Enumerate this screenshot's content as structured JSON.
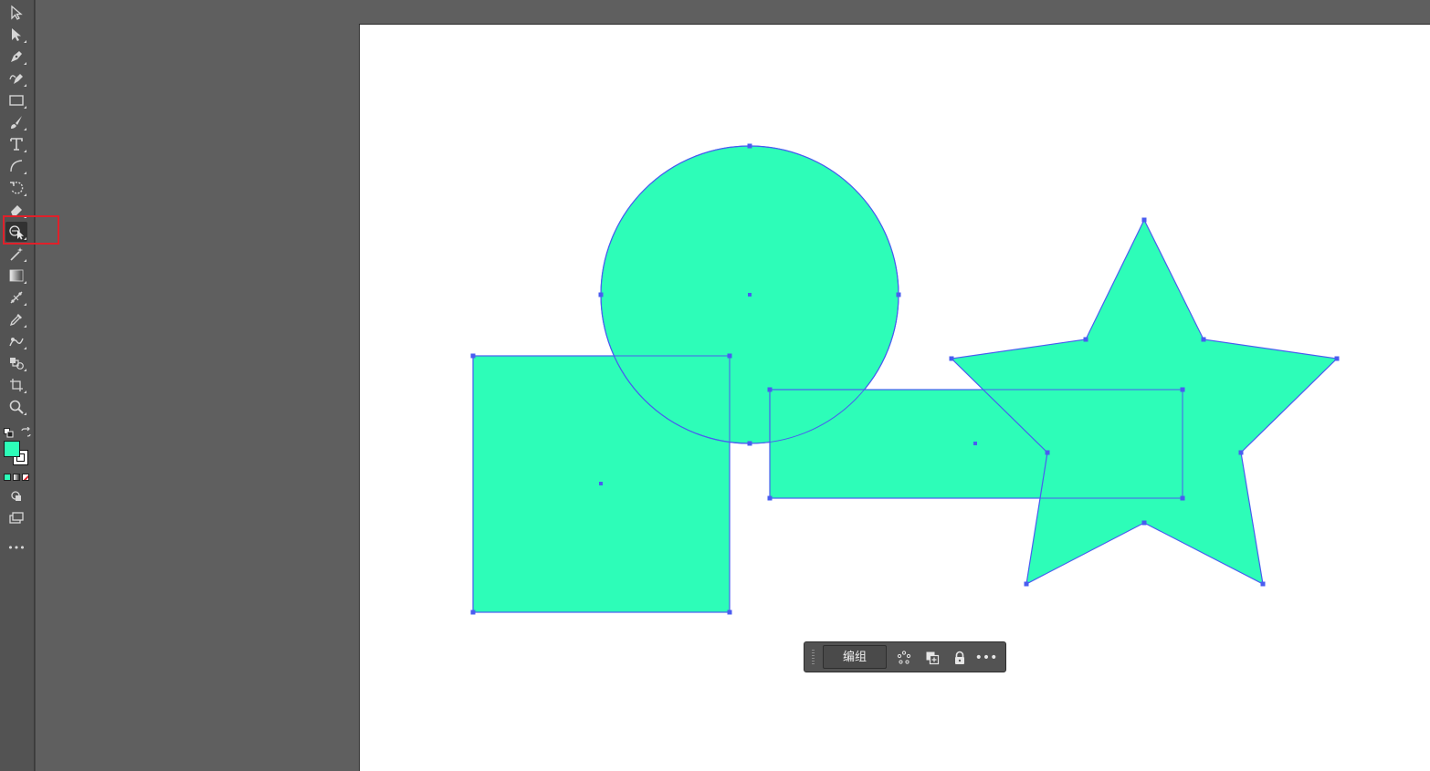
{
  "app": {
    "accent_color": "#2dfdb8",
    "selection_color": "#4a5cf0"
  },
  "toolbar": {
    "tools": [
      "selection-tool",
      "direct-selection-tool",
      "pen-tool",
      "curvature-tool",
      "rectangle-tool",
      "paintbrush-tool",
      "type-tool",
      "line-segment-tool",
      "rotate-tool",
      "eraser-tool",
      "shape-builder-tool",
      "magic-wand-tool",
      "gradient-tool",
      "puppet-warp-tool",
      "eyedropper-tool",
      "blend-tool",
      "symbol-sprayer-tool",
      "artboard-tool",
      "zoom-tool"
    ],
    "active_tool": "shape-builder-tool",
    "fill_color": "#2dfdb8",
    "stroke_color": "#000000",
    "more_label": "•••"
  },
  "context_bar": {
    "group_label": "编组",
    "more_label": "•••"
  }
}
